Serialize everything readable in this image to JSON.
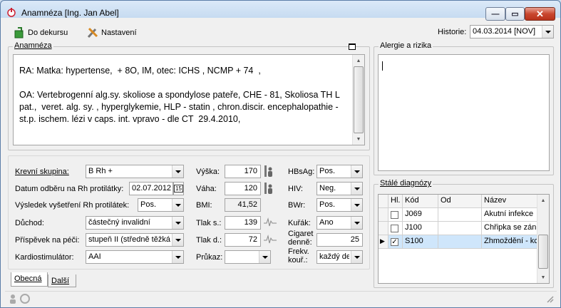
{
  "window": {
    "title": "Anamnéza [Ing. Jan Abel]"
  },
  "toolbar": {
    "dekurs_label": "Do dekursu",
    "settings_label": "Nastavení",
    "history_label": "Historie:",
    "history_value": "04.03.2014 [NOV]"
  },
  "anamneza": {
    "legend": "Anamnéza",
    "text": "RA: Matka: hypertense,  + 8O, IM, otec: ICHS , NCMP + 74  ,\n\nOA: Vertebrogenní alg.sy. skoliose a spondylose pateře, CHE - 81, Skoliosa TH L pat.,  veret. alg. sy. , hyperglykemie, HLP - statin , chron.discir. encephalopathie - st.p. ischem. lézi v caps. int. vpravo - dle CT  29.4.2010,"
  },
  "allergy": {
    "legend": "Alergie a rizika",
    "text": ""
  },
  "form": {
    "krevni_skupina_label": "Krevní skupina:",
    "krevni_skupina_value": "B Rh +",
    "datum_label": "Datum odběru na Rh protilátky:",
    "datum_value": "02.07.2012",
    "calendar_label": "15",
    "vysledek_label": "Výsledek vyšetření Rh protilátek:",
    "vysledek_value": "Pos.",
    "duchod_label": "Důchod:",
    "duchod_value": "částečný invalidní",
    "prispevek_label": "Příspěvek na péči:",
    "prispevek_value": "stupeň II (středně těžká",
    "kardio_label": "Kardiostimulátor:",
    "kardio_value": "AAI",
    "vyska_label": "Výška:",
    "vyska_value": "170",
    "vaha_label": "Váha:",
    "vaha_value": "120",
    "bmi_label": "BMI:",
    "bmi_value": "41,52",
    "tlak_s_label": "Tlak s.:",
    "tlak_s_value": "139",
    "tlak_d_label": "Tlak d.:",
    "tlak_d_value": "72",
    "prukaz_label": "Průkaz:",
    "prukaz_value": "",
    "hbsag_label": "HBsAg:",
    "hbsag_value": "Pos.",
    "hiv_label": "HIV:",
    "hiv_value": "Neg.",
    "bwr_label": "BWr:",
    "bwr_value": "Pos.",
    "kurak_label": "Kuřák:",
    "kurak_value": "Ano",
    "cigaret_label_1": "Cigaret",
    "cigaret_label_2": "denně:",
    "cigaret_value": "25",
    "frekv_label_1": "Frekv.",
    "frekv_label_2": "kouř.:",
    "frekv_value": "každý de"
  },
  "tabs": [
    {
      "label": "Obecná"
    },
    {
      "label": "Další"
    }
  ],
  "diagnoses": {
    "legend": "Stálé diagnózy",
    "columns": [
      "Hl.",
      "Kód",
      "Od",
      "Název"
    ],
    "rows": [
      {
        "checked": false,
        "code": "J069",
        "od": "",
        "name": "Akutní infekce"
      },
      {
        "checked": false,
        "code": "J100",
        "od": "",
        "name": "Chřipka se zán"
      },
      {
        "checked": true,
        "code": "S100",
        "od": "",
        "name": "Zhmoždění - kc"
      }
    ],
    "check_mark": "✓",
    "current_marker": "▶"
  },
  "colors": {
    "selected_row": "#cfe6fb",
    "window_border": "#5c7ea8",
    "close_button": "#c9472f"
  }
}
